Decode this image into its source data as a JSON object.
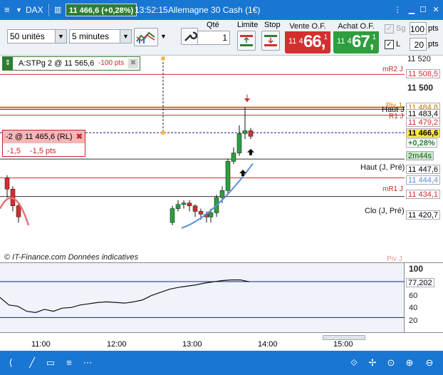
{
  "titlebar": {
    "symbol": "DAX",
    "price": "11 466,6 (+0,28%)",
    "time": "13:52:15",
    "instrument": "Allemagne 30 Cash (1€)",
    "colors": {
      "bar": "#1976d2",
      "price_bg": "#2e7d32"
    }
  },
  "toolbar": {
    "units_value": "50 unités",
    "period_value": "5 minutes",
    "qty_label": "Qté",
    "qty_value": "1",
    "limit_label": "Limite",
    "stop_label": "Stop",
    "sell_label": "Vente O.F.",
    "sell_prefix": "11 4",
    "sell_big": "66,",
    "sell_sup": "1",
    "buy_label": "Achat O.F.",
    "buy_prefix": "11 4",
    "buy_big": "67,",
    "buy_sup": "1",
    "sg_label": "Sg",
    "sg_value": "100",
    "sg_unit": "pts",
    "l_label": "L",
    "l_value": "20",
    "l_unit": "pts",
    "colors": {
      "sell": "#d32f2f",
      "buy": "#2e9e3e"
    }
  },
  "position": {
    "label": "A:STPg  2 @ 11 565,6",
    "pnl": "-100 pts"
  },
  "order_tag": {
    "label": "-2 @ 11 465,6 (RL)",
    "val1": "-1,5",
    "val2": "-1,5 pts"
  },
  "chart": {
    "lines": {
      "mR2": "mR2 J",
      "pivot": "Piv J",
      "r1": "R1 J",
      "haut": "Haut J",
      "haut_pre": "Haut (J, Pré)",
      "mR1": "mR1 J",
      "clo_pre": "Clo (J, Pré)",
      "piv_bottom": "Piv J"
    },
    "copyright": "© IT-Finance.com  Données indicatives"
  },
  "price_axis": {
    "ticks": [
      "11 520",
      "11 500"
    ],
    "boxes": [
      {
        "text": "11 508,5",
        "color": "#d32f2f"
      },
      {
        "text": "11 484,8",
        "color": "#c77700"
      },
      {
        "text": "11 483,4",
        "color": "#111"
      },
      {
        "text": "11 479,2",
        "color": "#d32f2f"
      },
      {
        "text": "11 466,6",
        "color": "#111"
      },
      {
        "text": "+0,28%",
        "color": "#2e7d32"
      },
      {
        "text": "2m44s",
        "color": "#2e7d32"
      },
      {
        "text": "11 447,6",
        "color": "#111"
      },
      {
        "text": "11 444,4",
        "color": "#5b8fd8"
      },
      {
        "text": "11 434,1",
        "color": "#d32f2f"
      },
      {
        "text": "11 420,7",
        "color": "#111"
      }
    ]
  },
  "osc_axis": {
    "ticks": [
      "100",
      "77,202",
      "60",
      "40",
      "20"
    ]
  },
  "time_axis": {
    "ticks": [
      "11:00",
      "12:00",
      "13:00",
      "14:00",
      "15:00"
    ]
  },
  "chart_data": {
    "type": "candlestick",
    "price_axis_ticks": [
      11520,
      11500
    ],
    "levels": [
      {
        "name": "mR2 J",
        "value": 11508.5
      },
      {
        "name": "Piv J",
        "value": 11484.8
      },
      {
        "name": "Haut J",
        "value": 11483.4
      },
      {
        "name": "R1 J",
        "value": 11479.2
      },
      {
        "name": "last",
        "value": 11466.6
      },
      {
        "name": "Haut (J, Pré)",
        "value": 11447.6
      },
      {
        "name": "moving average",
        "value": 11444.4
      },
      {
        "name": "mR1 J",
        "value": 11434.1
      },
      {
        "name": "Clo (J, Pré)",
        "value": 11420.7
      }
    ],
    "oscillator": {
      "ticks": [
        100,
        60,
        40,
        20
      ],
      "last": 77.202
    },
    "x_ticks": [
      "11:00",
      "12:00",
      "13:00",
      "14:00",
      "15:00"
    ]
  }
}
